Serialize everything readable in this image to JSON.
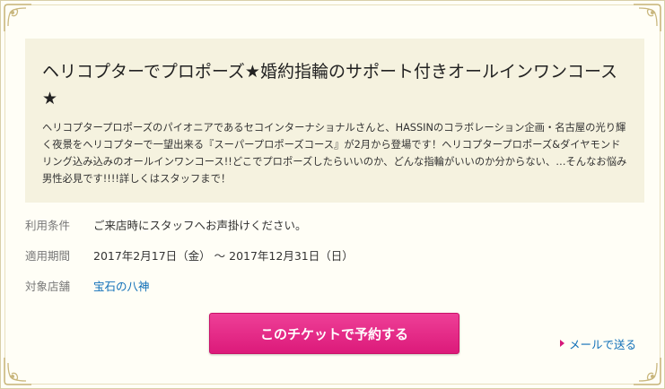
{
  "intro": {
    "title": "ヘリコプターでプロポーズ★婚約指輪のサポート付きオールインワンコース★",
    "description": "ヘリコプタープロポーズのパイオニアであるセコインターナショナルさんと、HASSINのコラボレーション企画・名古屋の光り輝く夜景をヘリコプターで一望出来る『スーパープロポーズコース』が2月から登場です！ヘリコプタープロポーズ&ダイヤモンドリング込み込みのオールインワンコース!!どこでプロポーズしたらいいのか、どんな指輪がいいのか分からない、…そんなお悩み男性必見です!!!!詳しくはスタッフまで！"
  },
  "conditions": {
    "usage_label": "利用条件",
    "usage_value": "ご来店時にスタッフへお声掛けください。",
    "period_label": "適用期間",
    "period_value": "2017年2月17日（金） 〜 2017年12月31日（日）",
    "store_label": "対象店舗",
    "store_value": "宝石の八神"
  },
  "actions": {
    "reserve_label": "このチケットで予約する",
    "mail_label": "メールで送る"
  },
  "colors": {
    "accent": "#e2257f",
    "link": "#0f6fb8",
    "panel": "#f5f2df",
    "frame": "#d9cfa8"
  },
  "icons": {
    "corners": "ornament-corner-icon",
    "mail": "triangle-right-icon"
  }
}
